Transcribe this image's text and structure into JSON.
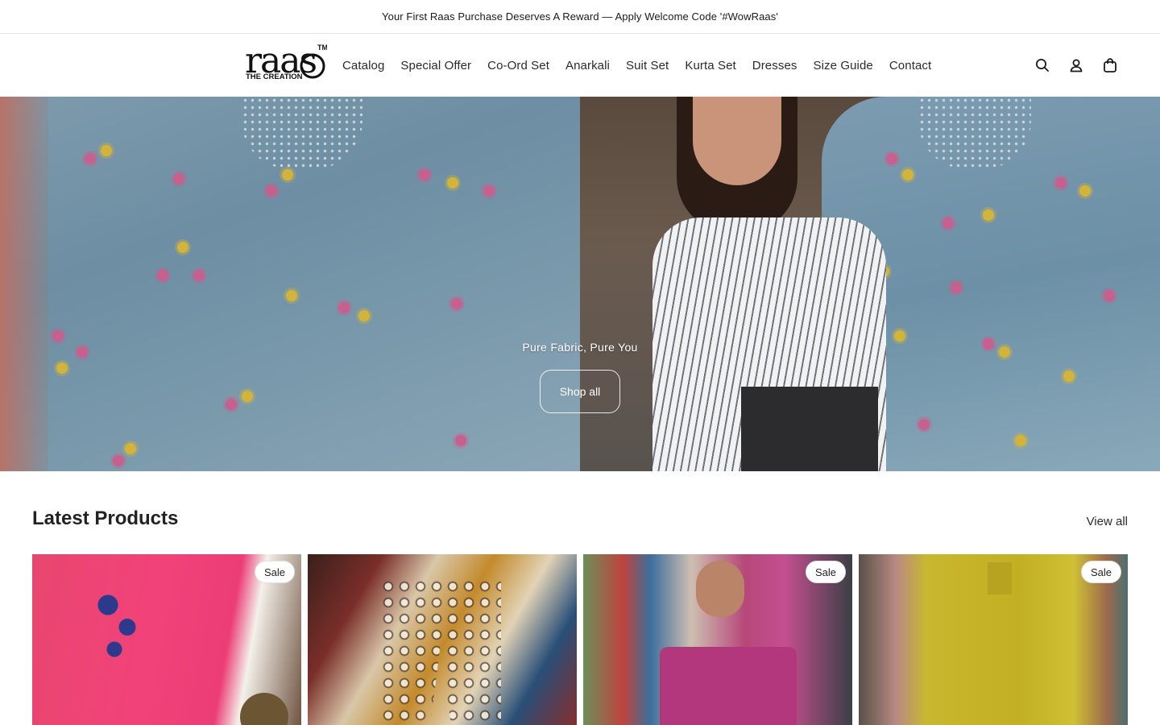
{
  "announcement": {
    "text": "Your First Raas Purchase Deserves A Reward — Apply Welcome Code '#WowRaas'"
  },
  "logo": {
    "main": "raas",
    "sub": "THE CREATION",
    "tm": "TM"
  },
  "nav": {
    "items": [
      {
        "label": "Catalog"
      },
      {
        "label": "Special Offer"
      },
      {
        "label": "Co-Ord Set"
      },
      {
        "label": "Anarkali"
      },
      {
        "label": "Suit Set"
      },
      {
        "label": "Kurta Set"
      },
      {
        "label": "Dresses"
      },
      {
        "label": "Size Guide"
      },
      {
        "label": "Contact"
      }
    ]
  },
  "header_icons": [
    "search-icon",
    "account-icon",
    "cart-icon"
  ],
  "hero": {
    "title": "Pure Fabric, Pure You",
    "button": "Shop all"
  },
  "latest": {
    "title": "Latest Products",
    "view_all": "View all",
    "products": [
      {
        "badge": "Sale"
      },
      {
        "badge": ""
      },
      {
        "badge": "Sale"
      },
      {
        "badge": "Sale"
      }
    ]
  }
}
